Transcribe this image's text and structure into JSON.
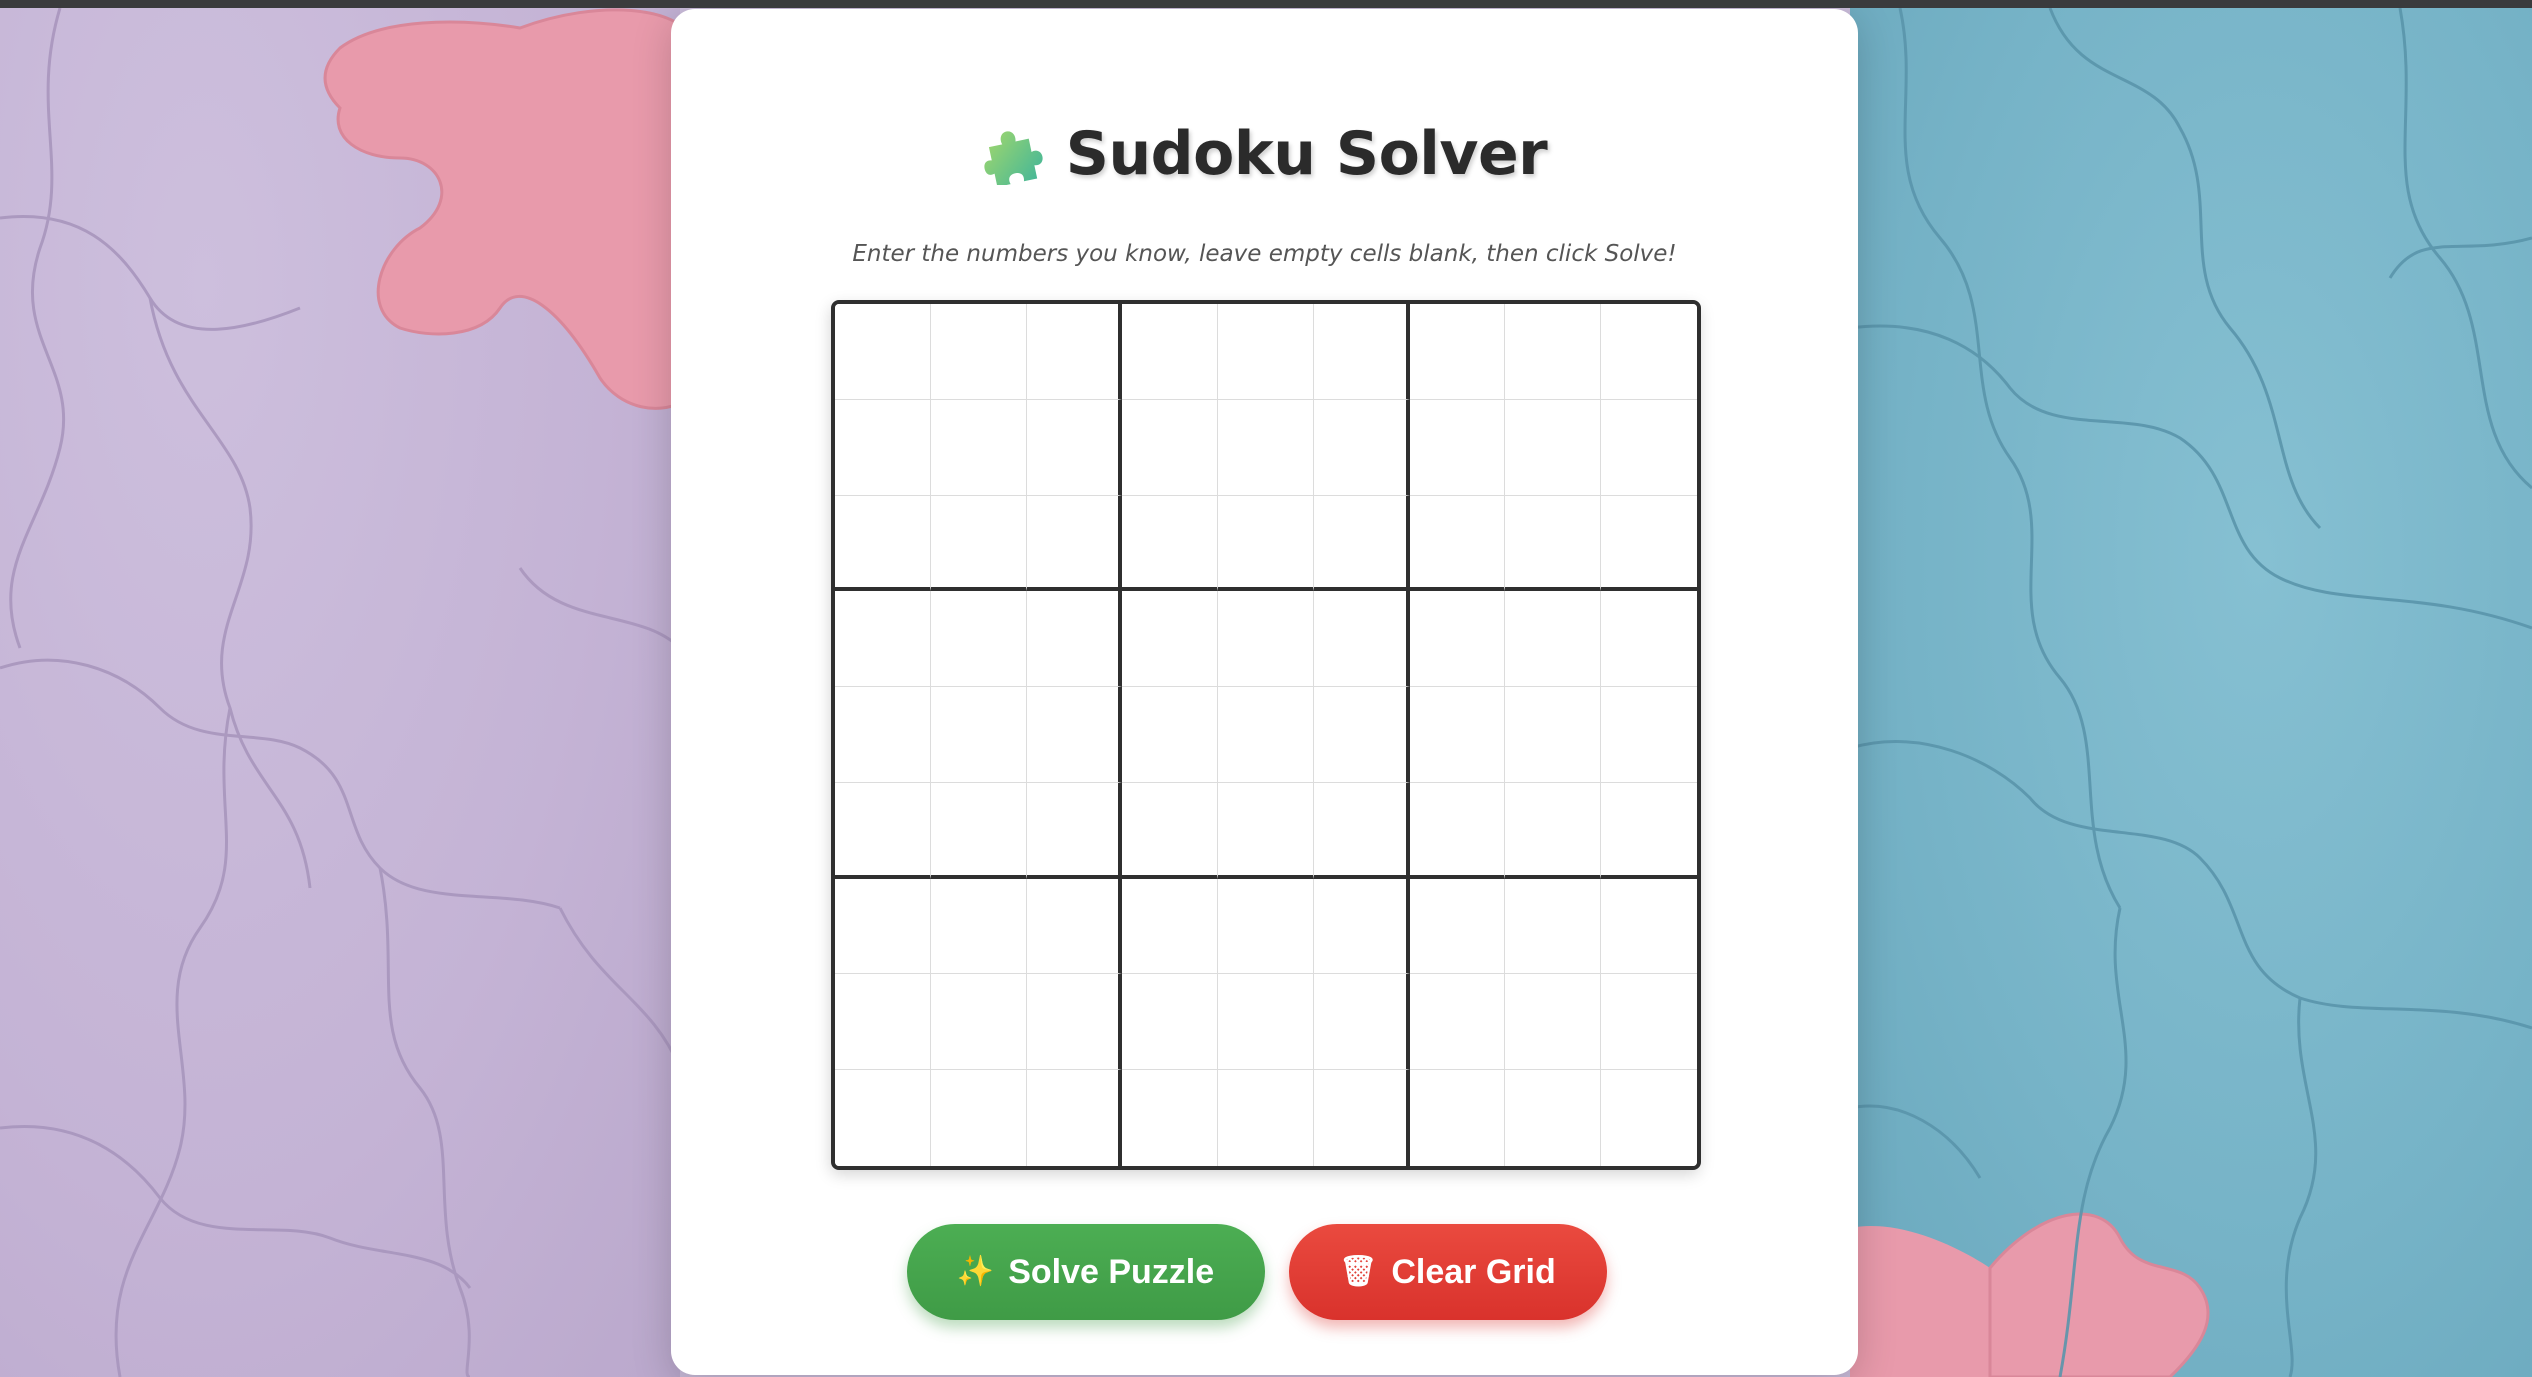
{
  "app": {
    "title": "Sudoku Solver",
    "subtitle": "Enter the numbers you know, leave empty cells blank, then click Solve!",
    "title_icon": "puzzle-piece-icon"
  },
  "grid": {
    "size": 9,
    "box_size": 3,
    "cells": [
      [
        "",
        "",
        "",
        "",
        "",
        "",
        "",
        "",
        ""
      ],
      [
        "",
        "",
        "",
        "",
        "",
        "",
        "",
        "",
        ""
      ],
      [
        "",
        "",
        "",
        "",
        "",
        "",
        "",
        "",
        ""
      ],
      [
        "",
        "",
        "",
        "",
        "",
        "",
        "",
        "",
        ""
      ],
      [
        "",
        "",
        "",
        "",
        "",
        "",
        "",
        "",
        ""
      ],
      [
        "",
        "",
        "",
        "",
        "",
        "",
        "",
        "",
        ""
      ],
      [
        "",
        "",
        "",
        "",
        "",
        "",
        "",
        "",
        ""
      ],
      [
        "",
        "",
        "",
        "",
        "",
        "",
        "",
        "",
        ""
      ],
      [
        "",
        "",
        "",
        "",
        "",
        "",
        "",
        "",
        ""
      ]
    ]
  },
  "buttons": {
    "solve": {
      "label": "Solve Puzzle",
      "icon": "sparkles-icon",
      "glyph": "✨",
      "color": "#43a047"
    },
    "clear": {
      "label": "Clear Grid",
      "icon": "trash-icon",
      "glyph": "🗑",
      "color": "#e53935"
    }
  },
  "colors": {
    "background_left": "#c4b3d5",
    "background_right": "#76b3c7",
    "accent_pink": "#e89aab",
    "card": "#ffffff",
    "grid_border": "#2f2f2f"
  }
}
